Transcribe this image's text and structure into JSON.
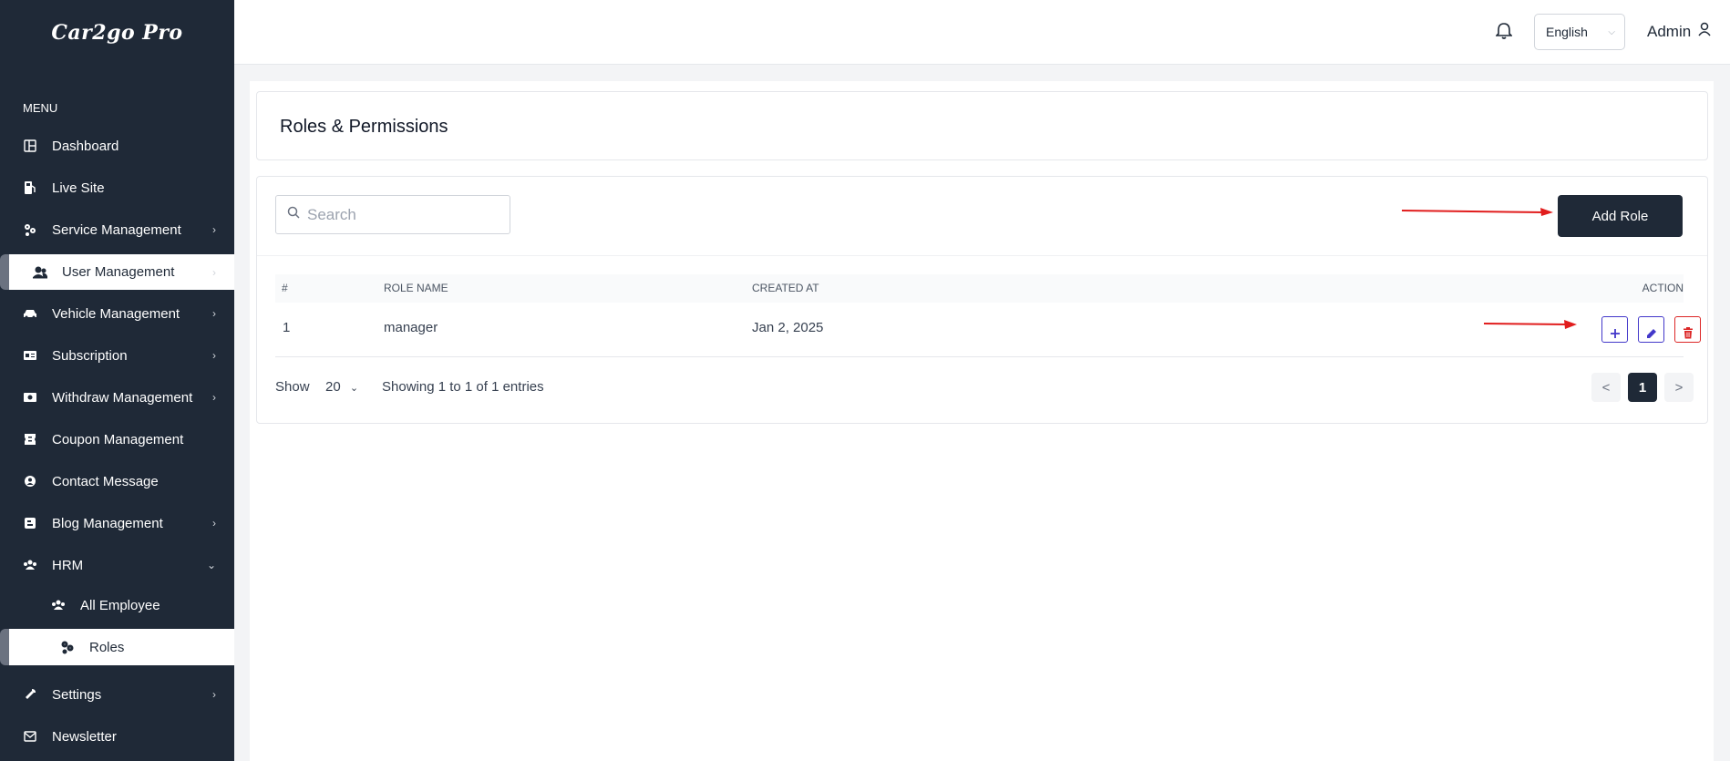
{
  "app": {
    "logo": "Car2go Pro"
  },
  "sidebar": {
    "menu_label": "MENU",
    "items": [
      {
        "label": "Dashboard",
        "icon": "dashboard-icon",
        "has_chevron": false
      },
      {
        "label": "Live Site",
        "icon": "gas-pump-icon",
        "has_chevron": false
      },
      {
        "label": "Service Management",
        "icon": "gears-icon",
        "has_chevron": true
      },
      {
        "label": "User Management",
        "icon": "users-icon",
        "has_chevron": true,
        "active": true
      },
      {
        "label": "Vehicle Management",
        "icon": "car-icon",
        "has_chevron": true
      },
      {
        "label": "Subscription",
        "icon": "id-card-icon",
        "has_chevron": true
      },
      {
        "label": "Withdraw Management",
        "icon": "money-icon",
        "has_chevron": true
      },
      {
        "label": "Coupon Management",
        "icon": "ticket-icon",
        "has_chevron": false
      },
      {
        "label": "Contact Message",
        "icon": "contact-icon",
        "has_chevron": false
      },
      {
        "label": "Blog Management",
        "icon": "blog-icon",
        "has_chevron": true
      },
      {
        "label": "HRM",
        "icon": "people-group-icon",
        "has_chevron": true,
        "expanded": true
      },
      {
        "label": "All Employee",
        "icon": "users-icon",
        "sub": true
      },
      {
        "label": "Roles",
        "icon": "gears-icon",
        "sub": true,
        "active": true
      },
      {
        "label": "Settings",
        "icon": "wrench-icon",
        "has_chevron": true
      },
      {
        "label": "Newsletter",
        "icon": "envelope-icon",
        "has_chevron": false
      }
    ]
  },
  "header": {
    "language": "English",
    "user": "Admin"
  },
  "page": {
    "title": "Roles & Permissions",
    "search_placeholder": "Search",
    "add_button": "Add Role",
    "table": {
      "columns": [
        "#",
        "ROLE NAME",
        "CREATED AT",
        "ACTION"
      ],
      "rows": [
        {
          "index": "1",
          "role_name": "manager",
          "created_at": "Jan 2, 2025"
        }
      ]
    },
    "footer": {
      "show_label": "Show",
      "page_size": "20",
      "entries_text": "Showing 1 to 1 of 1 entries",
      "prev": "<",
      "current_page": "1",
      "next": ">"
    }
  },
  "colors": {
    "sidebar_bg": "#1f2937",
    "primary": "#1f2937",
    "action_blue": "#4338ca",
    "action_red": "#dc2626",
    "annotation_arrow": "#e11d1d"
  }
}
